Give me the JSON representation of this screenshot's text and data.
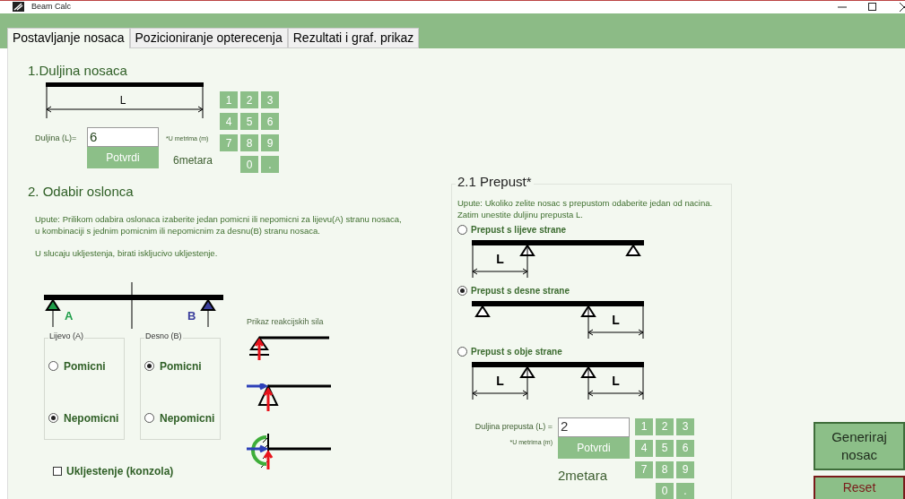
{
  "window": {
    "title": "Beam Calc"
  },
  "tabs": [
    {
      "label": "Postavljanje nosaca",
      "selected": true
    },
    {
      "label": "Pozicioniranje opterecenja",
      "selected": false
    },
    {
      "label": "Rezultati i  graf. prikaz",
      "selected": false
    }
  ],
  "length_section": {
    "title": "1.Duljina nosaca",
    "dimension_label": "L",
    "field_label": "Duljina (L)=",
    "value": "6",
    "unit_note": "*U metrima (m)",
    "confirm_button": "Potvrdi",
    "result": "6metara",
    "keypad": [
      "1",
      "2",
      "3",
      "4",
      "5",
      "6",
      "7",
      "8",
      "9",
      "0",
      "."
    ]
  },
  "supports_section": {
    "title": "2. Odabir oslonca",
    "instructions": [
      "Upute: Prilikom odabira oslonaca izaberite jedan pomicni ili nepomicni za lijevu(A) stranu nosaca,",
      "u kombinaciji s jednim pomicnim ili nepomicnim za desnu(B)  stranu nosaca."
    ],
    "note": "U slucaju ukljestenja, birati iskljucivo ukljestenje.",
    "supports": [
      {
        "label": "A",
        "color": "#1f9e4a"
      },
      {
        "label": "B",
        "color": "#3b3f9c"
      }
    ],
    "groups": [
      {
        "title": "Lijevo (A)",
        "options": [
          {
            "label": "Pomicni",
            "selected": false
          },
          {
            "label": "Nepomicni",
            "selected": true
          }
        ]
      },
      {
        "title": "Desno (B)",
        "options": [
          {
            "label": "Pomicni",
            "selected": true
          },
          {
            "label": "Nepomicni",
            "selected": false
          }
        ]
      }
    ],
    "clamp": {
      "label": "Ukljestenje (konzola)",
      "checked": false
    },
    "reactions_title": "Prikaz reakcijskih sila"
  },
  "overhang_section": {
    "title": "2.1 Prepust*",
    "instructions": [
      "Upute: Ukoliko zelite nosac s prepustom odaberite jedan od nacina.",
      "Zatim unestite duljinu prepusta L."
    ],
    "options": [
      {
        "label": "Prepust s lijeve strane",
        "selected": false,
        "kind": "left",
        "dimension_labels": [
          "L"
        ]
      },
      {
        "label": "Prepust s desne strane",
        "selected": true,
        "kind": "right",
        "dimension_labels": [
          "L"
        ]
      },
      {
        "label": "Prepust s obje strane",
        "selected": false,
        "kind": "both",
        "dimension_labels": [
          "L",
          "L"
        ]
      }
    ],
    "field_label": "Duljina prepusta (L) =",
    "unit_note": "*U metrima (m)",
    "value": "2",
    "confirm_button": "Potvrdi",
    "result": "2metara",
    "keypad": [
      "1",
      "2",
      "3",
      "4",
      "5",
      "6",
      "7",
      "8",
      "9",
      "0",
      "."
    ]
  },
  "actions": [
    {
      "label": "Generiraj nosac",
      "kind": "primary"
    },
    {
      "label": "Reset",
      "kind": "danger"
    }
  ]
}
